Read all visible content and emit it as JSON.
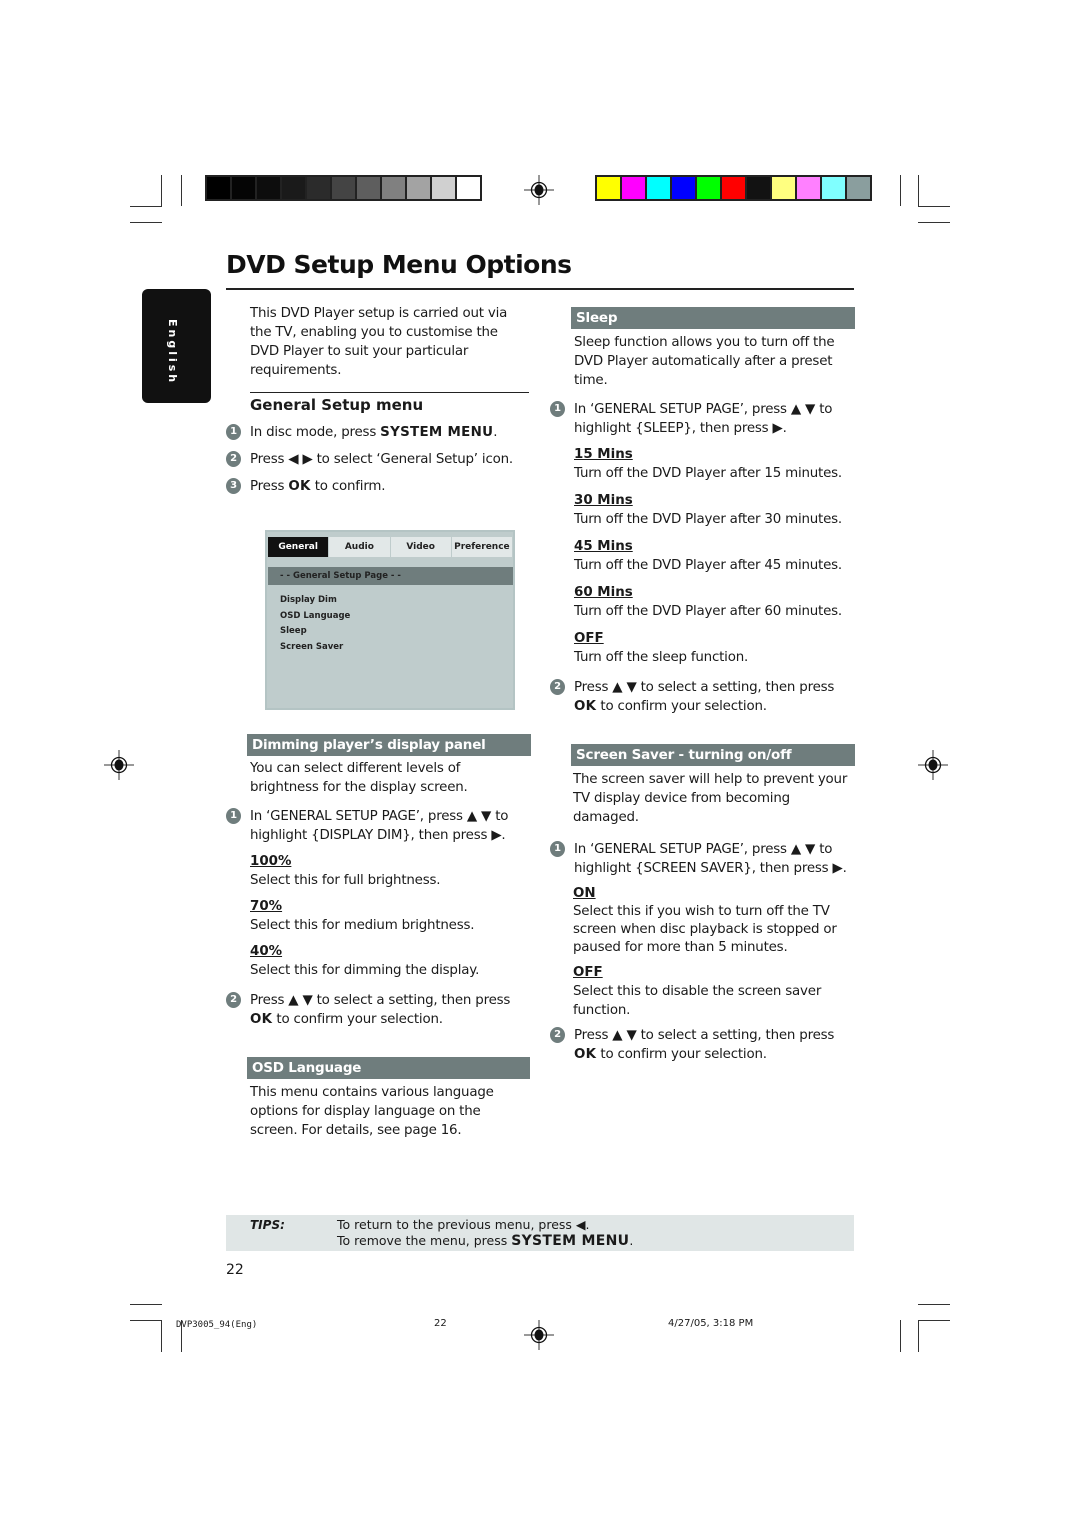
{
  "print_marks": {
    "grayscale_swatches": [
      "#000000",
      "#050505",
      "#0d0d0d",
      "#1a1a1a",
      "#2b2b2b",
      "#444444",
      "#5e5e5e",
      "#808080",
      "#a3a3a3",
      "#d0d0d0",
      "#ffffff"
    ],
    "color_swatches": [
      "#ffff00",
      "#ff00ff",
      "#00ffff",
      "#0000ff",
      "#00ff00",
      "#ff0000",
      "#121212",
      "#ffff80",
      "#ff80ff",
      "#80ffff",
      "#8a9e9e"
    ],
    "footer_file": "DVP3005_94(Eng)",
    "footer_page": "22",
    "footer_date": "4/27/05, 3:18 PM"
  },
  "page": {
    "title": "DVD Setup Menu Options",
    "language_tab": "English",
    "page_number": "22",
    "accent_color": "#6f7d7d"
  },
  "intro": "This DVD Player setup is carried out via the TV, enabling you to customise the DVD Player to suit your particular requirements.",
  "general_setup": {
    "heading": "General Setup menu",
    "steps": [
      {
        "num": "1",
        "pre": "In disc mode, press ",
        "key": "SYSTEM MENU",
        "post": "."
      },
      {
        "num": "2",
        "pre": "Press ◀ ▶ to select ‘General Setup’ icon.",
        "key": "",
        "post": ""
      },
      {
        "num": "3",
        "pre": "Press ",
        "key": "OK",
        "post": " to confirm."
      }
    ]
  },
  "menu_screen": {
    "tabs": [
      "General",
      "Audio",
      "Video",
      "Preference"
    ],
    "selected_tab": "General",
    "page_title": "- -   General Setup Page   - -",
    "items": [
      "Display Dim",
      "OSD Language",
      "Sleep",
      "Screen Saver"
    ]
  },
  "dimming": {
    "heading": "Dimming player’s display panel",
    "desc": "You can select different levels of brightness for the display screen.",
    "step1": "In ‘GENERAL SETUP PAGE’, press ▲ ▼ to highlight {DISPLAY DIM}, then press ▶.",
    "options": [
      {
        "label": "100%",
        "desc": "Select this for full brightness."
      },
      {
        "label": "70%",
        "desc": "Select this for medium brightness."
      },
      {
        "label": "40%",
        "desc": "Select this for dimming the display."
      }
    ],
    "step2_pre": "Press ▲ ▼ to select a setting, then press ",
    "step2_key": "OK",
    "step2_post": " to confirm your selection."
  },
  "osd": {
    "heading": "OSD Language",
    "desc": "This menu contains various language options for display language on the screen.  For details, see page 16."
  },
  "sleep": {
    "heading": "Sleep",
    "desc": "Sleep function allows you to turn off the DVD Player automatically after a preset time.",
    "step1": "In ‘GENERAL SETUP PAGE’, press ▲ ▼ to highlight {SLEEP}, then press ▶.",
    "options": [
      {
        "label": "15 Mins",
        "desc": "Turn off the DVD Player after 15 minutes."
      },
      {
        "label": "30 Mins",
        "desc": "Turn off the DVD Player after 30 minutes."
      },
      {
        "label": "45 Mins",
        "desc": "Turn off the DVD Player after 45 minutes."
      },
      {
        "label": "60 Mins",
        "desc": "Turn off the DVD Player after 60 minutes."
      },
      {
        "label": "OFF",
        "desc": "Turn off the sleep function."
      }
    ],
    "step2_pre": "Press ▲ ▼ to select a setting, then press ",
    "step2_key": "OK",
    "step2_post": " to confirm your selection."
  },
  "screensaver": {
    "heading": "Screen Saver - turning on/off",
    "desc": "The screen saver will help to prevent your TV display device from becoming damaged.",
    "step1": "In ‘GENERAL SETUP PAGE’, press ▲ ▼ to highlight {SCREEN SAVER}, then press ▶.",
    "options": [
      {
        "label": "ON",
        "desc": "Select this if you wish to turn off the TV screen when disc playback is stopped or paused for more than 5 minutes."
      },
      {
        "label": "OFF",
        "desc": "Select this to disable the screen saver function."
      }
    ],
    "step2_pre": "Press ▲ ▼ to select a setting, then press ",
    "step2_key": "OK",
    "step2_post": " to confirm your selection."
  },
  "tips": {
    "label": "TIPS:",
    "line1": "To return to the previous menu, press ◀.",
    "line2_pre": "To remove the menu, press ",
    "line2_key": "SYSTEM MENU",
    "line2_post": "."
  }
}
